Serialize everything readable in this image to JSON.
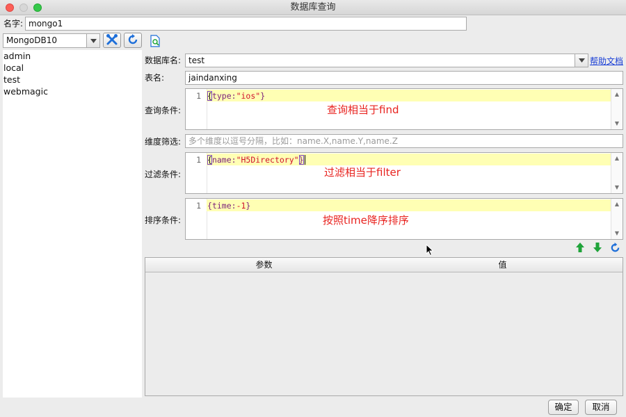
{
  "window": {
    "title": "数据库查询"
  },
  "name_field": {
    "label": "名字:",
    "value": "mongo1"
  },
  "connection": {
    "selected": "MongoDB10"
  },
  "databases": [
    "admin",
    "local",
    "test",
    "webmagic"
  ],
  "form": {
    "db_label": "数据库名:",
    "db_value": "test",
    "help_link": "帮助文档",
    "table_label": "表名:",
    "table_value": "jaindanxing",
    "query_label": "查询条件:",
    "query_line": "1",
    "query_code": {
      "open": "{",
      "key": "type:",
      "str": "\"ios\"",
      "close": "}"
    },
    "query_note": "查询相当于find",
    "dims_label": "维度筛选:",
    "dims_placeholder": "多个维度以逗号分隔，比如：name.X,name.Y,name.Z",
    "filter_label": "过滤条件:",
    "filter_line": "1",
    "filter_code": {
      "open": "{",
      "key": "name:",
      "str": "\"H5Directory\"",
      "close": "}"
    },
    "filter_note": "过滤相当于filter",
    "sort_label": "排序条件:",
    "sort_line": "1",
    "sort_code": {
      "open": "{",
      "key": "time:",
      "num": "-1",
      "close": "}"
    },
    "sort_note": "按照time降序排序"
  },
  "params_table": {
    "columns": [
      "参数",
      "值"
    ],
    "rows": []
  },
  "footer": {
    "ok": "确定",
    "cancel": "取消"
  },
  "colors": {
    "accent_red": "#e8231f",
    "icon_green": "#1fa33a",
    "icon_blue": "#1e6fd9",
    "link": "#1a3fd6"
  },
  "icons": [
    "tools-icon",
    "refresh-icon",
    "query-doc-icon",
    "move-up-icon",
    "move-down-icon"
  ]
}
